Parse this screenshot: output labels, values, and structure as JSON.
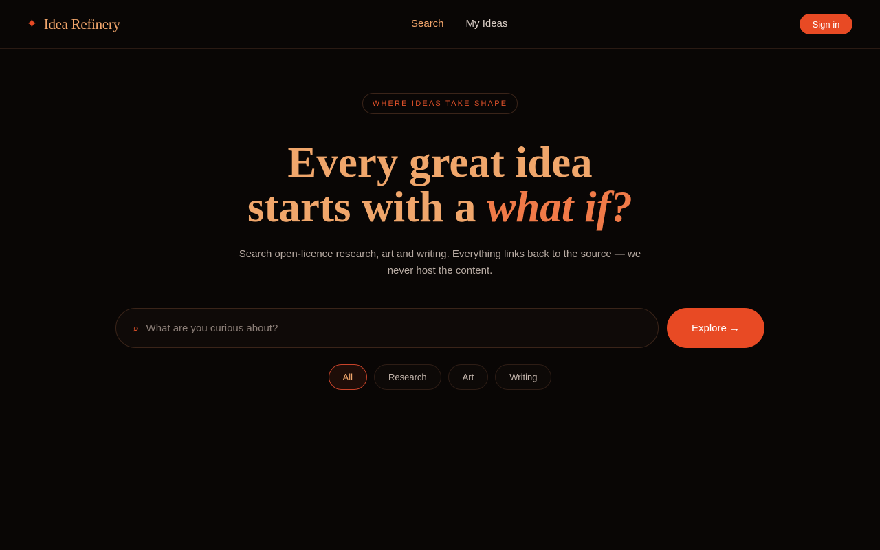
{
  "brand": {
    "icon": "sparkle-icon",
    "name": "Idea Refinery"
  },
  "nav": {
    "items": [
      {
        "label": "Search",
        "active": true
      },
      {
        "label": "My Ideas",
        "active": false
      }
    ]
  },
  "auth": {
    "signin_label": "Sign in"
  },
  "hero": {
    "tagline": "WHERE IDEAS TAKE SHAPE",
    "headline_line1": "Every great idea",
    "headline_line2_prefix": "starts with a ",
    "headline_line2_accent": "what if?",
    "subtitle": "Search open-licence research, art and writing. Everything links back to the source — we never host the content."
  },
  "search": {
    "icon": "search-icon",
    "placeholder": "What are you curious about?",
    "value": "",
    "button_label": "Explore →"
  },
  "filters": {
    "chips": [
      {
        "label": "All",
        "active": true
      },
      {
        "label": "Research",
        "active": false
      },
      {
        "label": "Art",
        "active": false
      },
      {
        "label": "Writing",
        "active": false
      }
    ]
  },
  "colors": {
    "background": "#090605",
    "accent": "#e84a24",
    "headline": "#f0a66b",
    "headline_accent": "#f07a48"
  }
}
